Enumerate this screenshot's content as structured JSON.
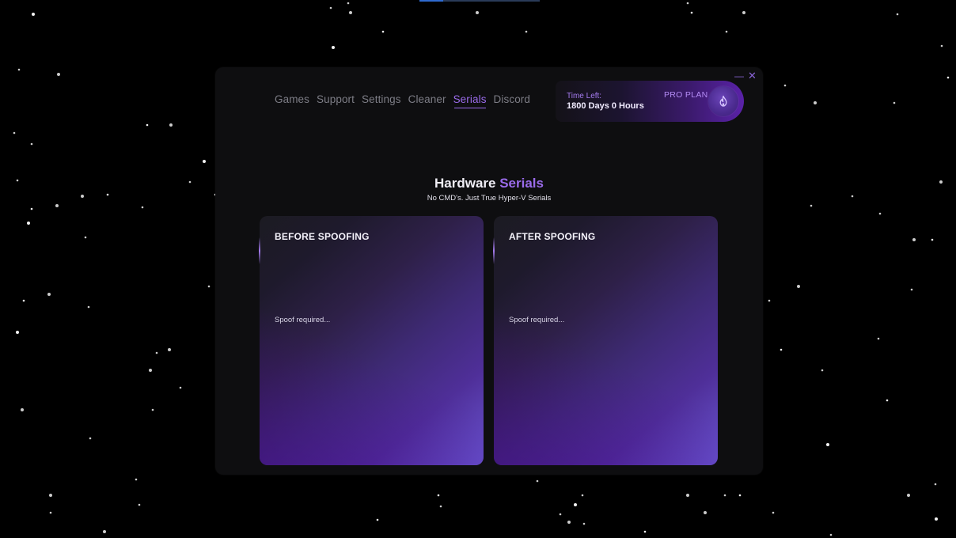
{
  "nav": {
    "items": [
      {
        "label": "Games",
        "active": false
      },
      {
        "label": "Support",
        "active": false
      },
      {
        "label": "Settings",
        "active": false
      },
      {
        "label": "Cleaner",
        "active": false
      },
      {
        "label": "Serials",
        "active": true
      },
      {
        "label": "Discord",
        "active": false
      }
    ]
  },
  "plan": {
    "time_label": "Time Left:",
    "time_value": "1800 Days 0 Hours",
    "plan_name": "PRO PLAN",
    "badge_icon": "flame-icon"
  },
  "window_controls": {
    "minimize": "—",
    "close": "✕"
  },
  "page": {
    "title_main": "Hardware",
    "title_accent": "Serials",
    "subtitle": "No CMD's. Just True Hyper-V Serials"
  },
  "panels": {
    "before": {
      "heading": "BEFORE SPOOFING",
      "status": "Spoof required..."
    },
    "after": {
      "heading": "AFTER SPOOFING",
      "status": "Spoof required..."
    }
  },
  "colors": {
    "accent": "#9a6bea",
    "background": "#000000",
    "window": "#0e0e10"
  }
}
